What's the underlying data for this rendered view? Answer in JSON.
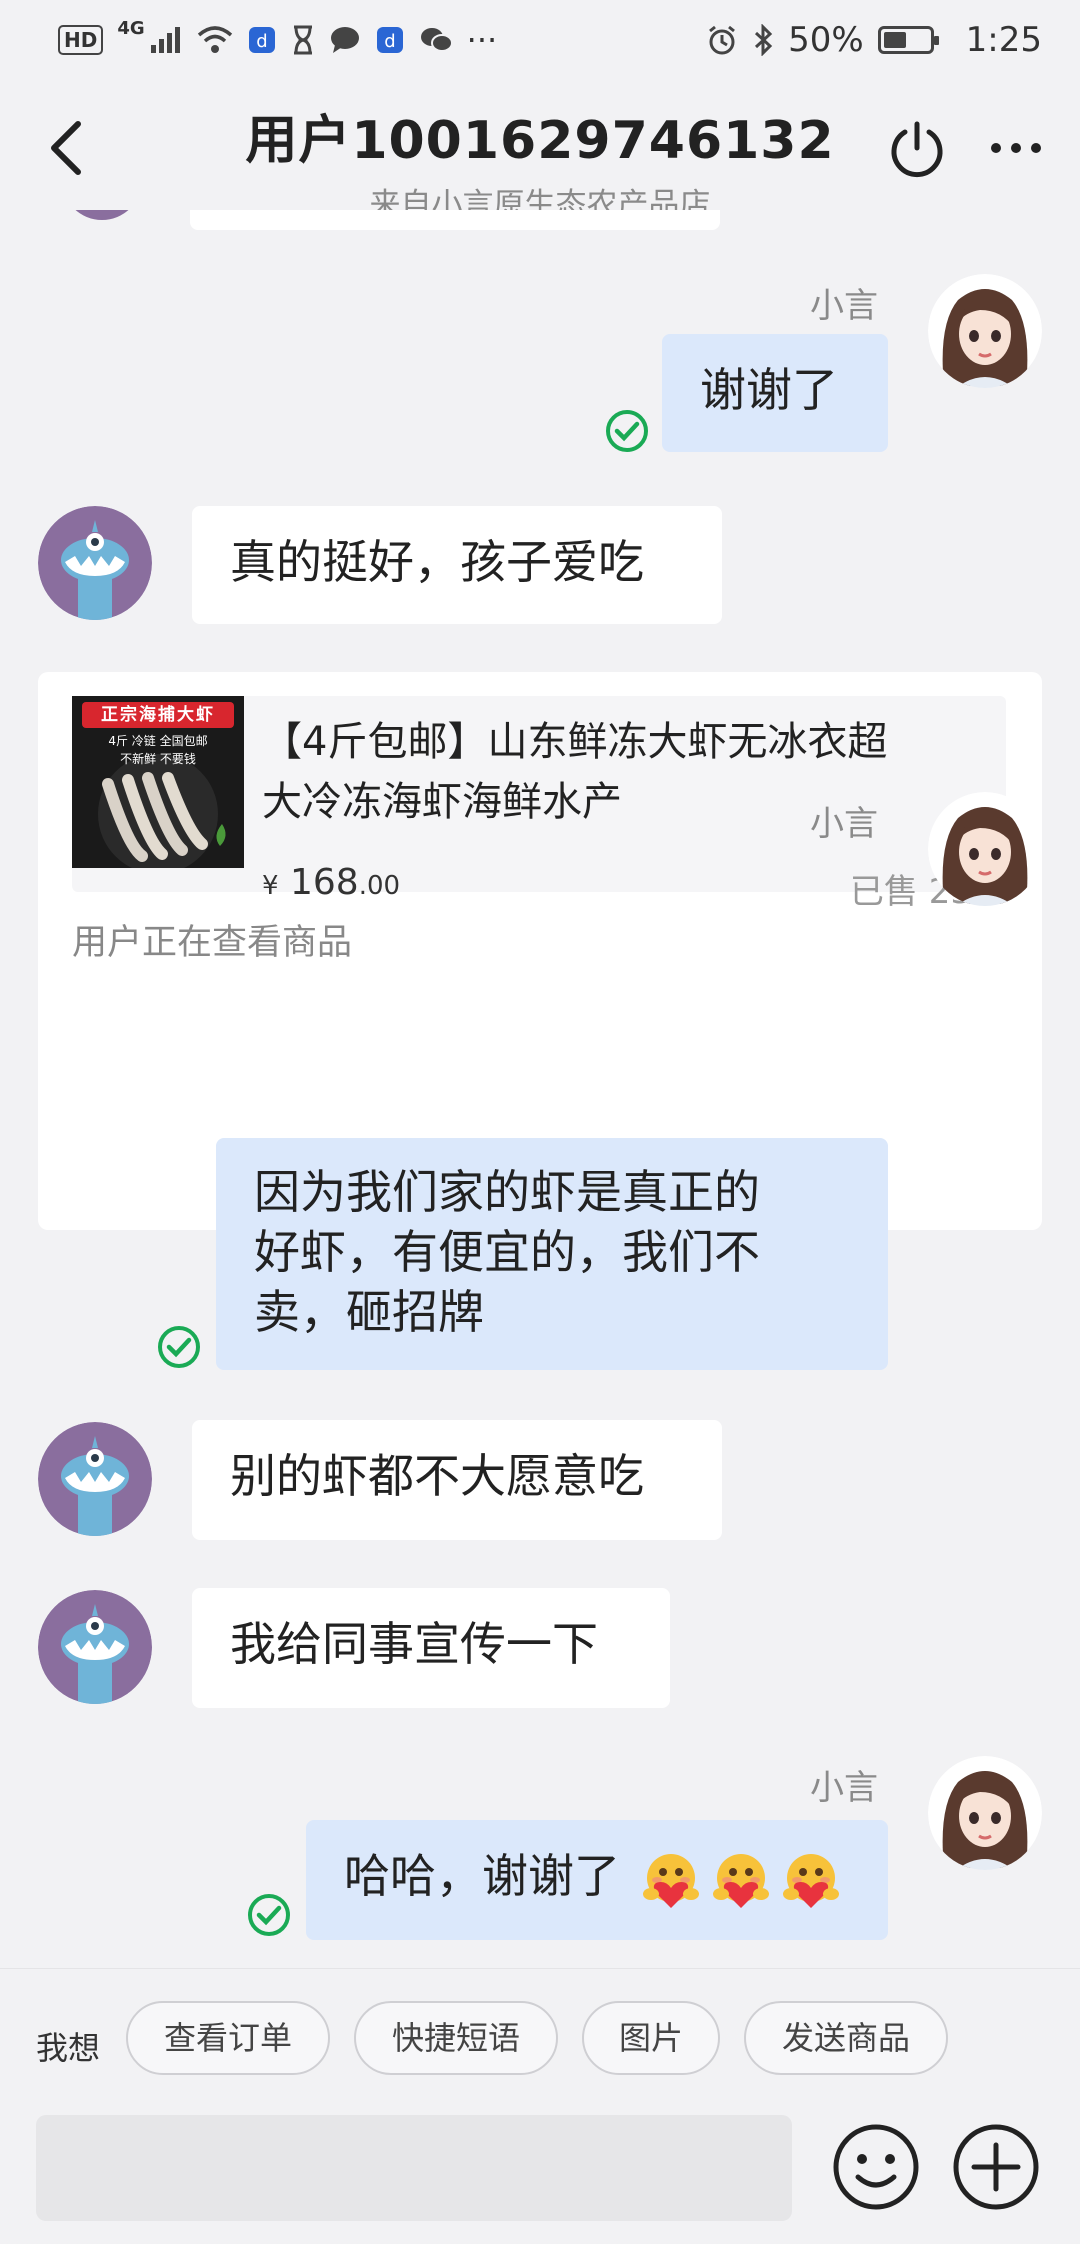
{
  "status_bar": {
    "left_badges": [
      "HD",
      "4G"
    ],
    "battery": "50%",
    "time": "1:25"
  },
  "header": {
    "title": "用户1001629746132",
    "subtitle": "来自小言原生态农产品店"
  },
  "messages": [
    {
      "sender": "小言",
      "text": "谢谢了"
    },
    {
      "text": "真的挺好，孩子爱吃"
    },
    {
      "sender": "小言",
      "line1": "因为我们家的虾是真正的",
      "line2": "好虾，有便宜的，我们不",
      "line3": "卖，砸招牌"
    },
    {
      "text": "别的虾都不大愿意吃"
    },
    {
      "text": "我给同事宣传一下"
    },
    {
      "sender": "小言",
      "text": "哈哈，谢谢了"
    }
  ],
  "product": {
    "image_banner": "正宗海捕大虾",
    "image_line2": "4斤 冷链 全国包邮",
    "image_line3": "不新鲜 不要钱",
    "title_line1": "【4斤包邮】山东鲜冻大虾无冰衣超",
    "title_line2": "大冷冻海虾海鲜水产",
    "price_symbol": "¥",
    "price_int": "168",
    "price_dec": ".00",
    "sold": "已售 23",
    "status": "用户正在查看商品"
  },
  "bottom": {
    "quick_label": "我想",
    "chips": [
      "查看订单",
      "快捷短语",
      "图片",
      "发送商品"
    ]
  },
  "colors": {
    "outgoing_bubble": "#dbe8fb",
    "incoming_bubble": "#ffffff",
    "check_green": "#1aaa55",
    "avatar_purple": "#8a6e9e",
    "monster_blue": "#6fb4d8"
  },
  "icons": [
    "back-arrow-icon",
    "power-icon",
    "more-dots-icon",
    "read-check-icon",
    "emoji-smile-icon",
    "plus-icon"
  ]
}
